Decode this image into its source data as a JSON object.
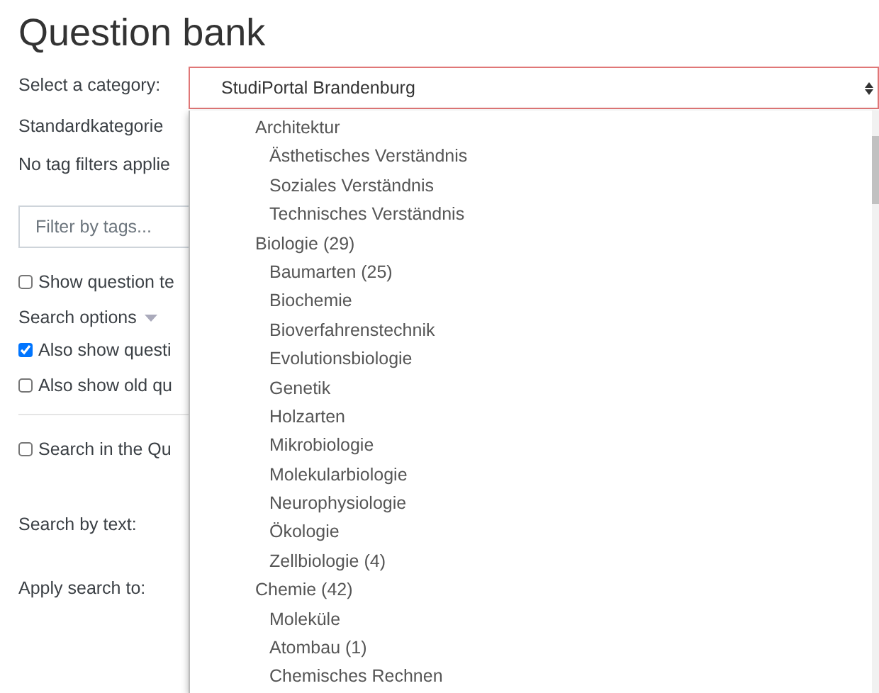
{
  "title": "Question bank",
  "category": {
    "label": "Select a category:",
    "value": "StudiPortal Brandenburg"
  },
  "context": "Standardkategorie",
  "tag_status": "No tag filters applie",
  "tag_filter": {
    "placeholder": "Filter by tags..."
  },
  "show_text": {
    "label": "Show question te",
    "checked": false
  },
  "search_options": {
    "label": "Search options"
  },
  "options": [
    {
      "label": "Also show questi",
      "checked": true
    },
    {
      "label": "Also show old qu",
      "checked": false
    }
  ],
  "search_in": {
    "label": "Search in the Qu",
    "checked": false
  },
  "search_text": {
    "label": "Search by text:"
  },
  "apply_to": {
    "label": "Apply search to:"
  },
  "dropdown": [
    {
      "label": "Architektur",
      "children": [
        {
          "label": "Ästhetisches Verständnis"
        },
        {
          "label": "Soziales Verständnis"
        },
        {
          "label": "Technisches Verständnis"
        }
      ]
    },
    {
      "label": "Biologie (29)",
      "children": [
        {
          "label": "Baumarten (25)"
        },
        {
          "label": "Biochemie"
        },
        {
          "label": "Bioverfahrenstechnik"
        },
        {
          "label": "Evolutionsbiologie"
        },
        {
          "label": "Genetik"
        },
        {
          "label": "Holzarten"
        },
        {
          "label": "Mikrobiologie"
        },
        {
          "label": "Molekularbiologie"
        },
        {
          "label": "Neurophysiologie"
        },
        {
          "label": "Ökologie"
        },
        {
          "label": "Zellbiologie (4)"
        }
      ]
    },
    {
      "label": "Chemie (42)",
      "children": [
        {
          "label": "Moleküle"
        },
        {
          "label": "Atombau (1)"
        },
        {
          "label": "Chemisches Rechnen"
        }
      ]
    }
  ]
}
